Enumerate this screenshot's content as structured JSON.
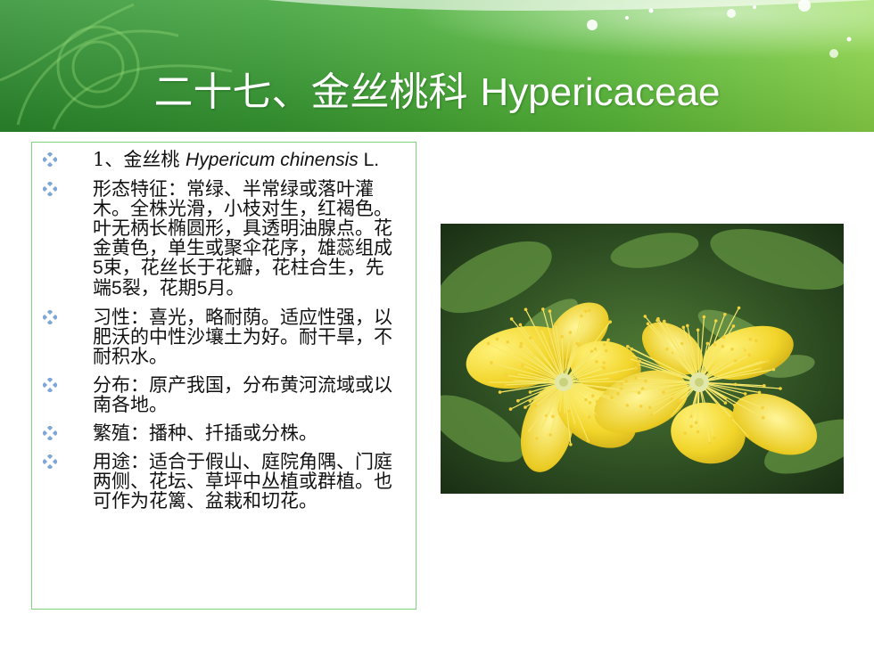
{
  "slide": {
    "title_cn": "二十七、金丝桃科 ",
    "title_latin": "Hypericaceae"
  },
  "colors": {
    "header_dark": "#1f8f2a",
    "header_light": "#7fd63e",
    "accent_green": "#7fd37a",
    "bullet_blue": "#7fa7d6",
    "flower_yellow": "#f2d52a"
  },
  "bullets": [
    {
      "icon": "diamond-bullet-icon",
      "parts": [
        {
          "t": "1、金丝桃 ",
          "s": "latin-start"
        },
        {
          "t": "Hypericum chinensis",
          "s": "italic"
        },
        {
          "t": " L.",
          "s": "latin"
        }
      ]
    },
    {
      "icon": "diamond-bullet-icon",
      "parts": [
        {
          "t": "形态特征：常绿、半常绿或落叶灌木。全株光滑，小枝对生，红褐色。叶无柄长椭圆形，具透明油腺点。花金黄色，单生或聚伞花序，雄蕊组成",
          "s": "cn"
        },
        {
          "t": "5",
          "s": "latin"
        },
        {
          "t": "束，花丝长于花瓣，花柱合生，先端",
          "s": "cn"
        },
        {
          "t": "5",
          "s": "latin"
        },
        {
          "t": "裂，花期",
          "s": "cn"
        },
        {
          "t": "5",
          "s": "latin"
        },
        {
          "t": "月。",
          "s": "cn"
        }
      ]
    },
    {
      "icon": "diamond-bullet-icon",
      "parts": [
        {
          "t": "习性：喜光，略耐荫。适应性强，以肥沃的中性沙壤土为好。耐干旱，不耐积水。",
          "s": "cn"
        }
      ]
    },
    {
      "icon": "diamond-bullet-icon",
      "parts": [
        {
          "t": "分布：原产我国，分布黄河流域或以南各地。",
          "s": "cn"
        }
      ]
    },
    {
      "icon": "diamond-bullet-icon",
      "parts": [
        {
          "t": "繁殖：播种、扦插或分株。",
          "s": "cn"
        }
      ]
    },
    {
      "icon": "diamond-bullet-icon",
      "parts": [
        {
          "t": "用途：适合于假山、庭院角隅、门庭两侧、花坛、草坪中丛植或群植。也可作为花篱、盆栽和切花。",
          "s": "cn"
        }
      ]
    }
  ]
}
